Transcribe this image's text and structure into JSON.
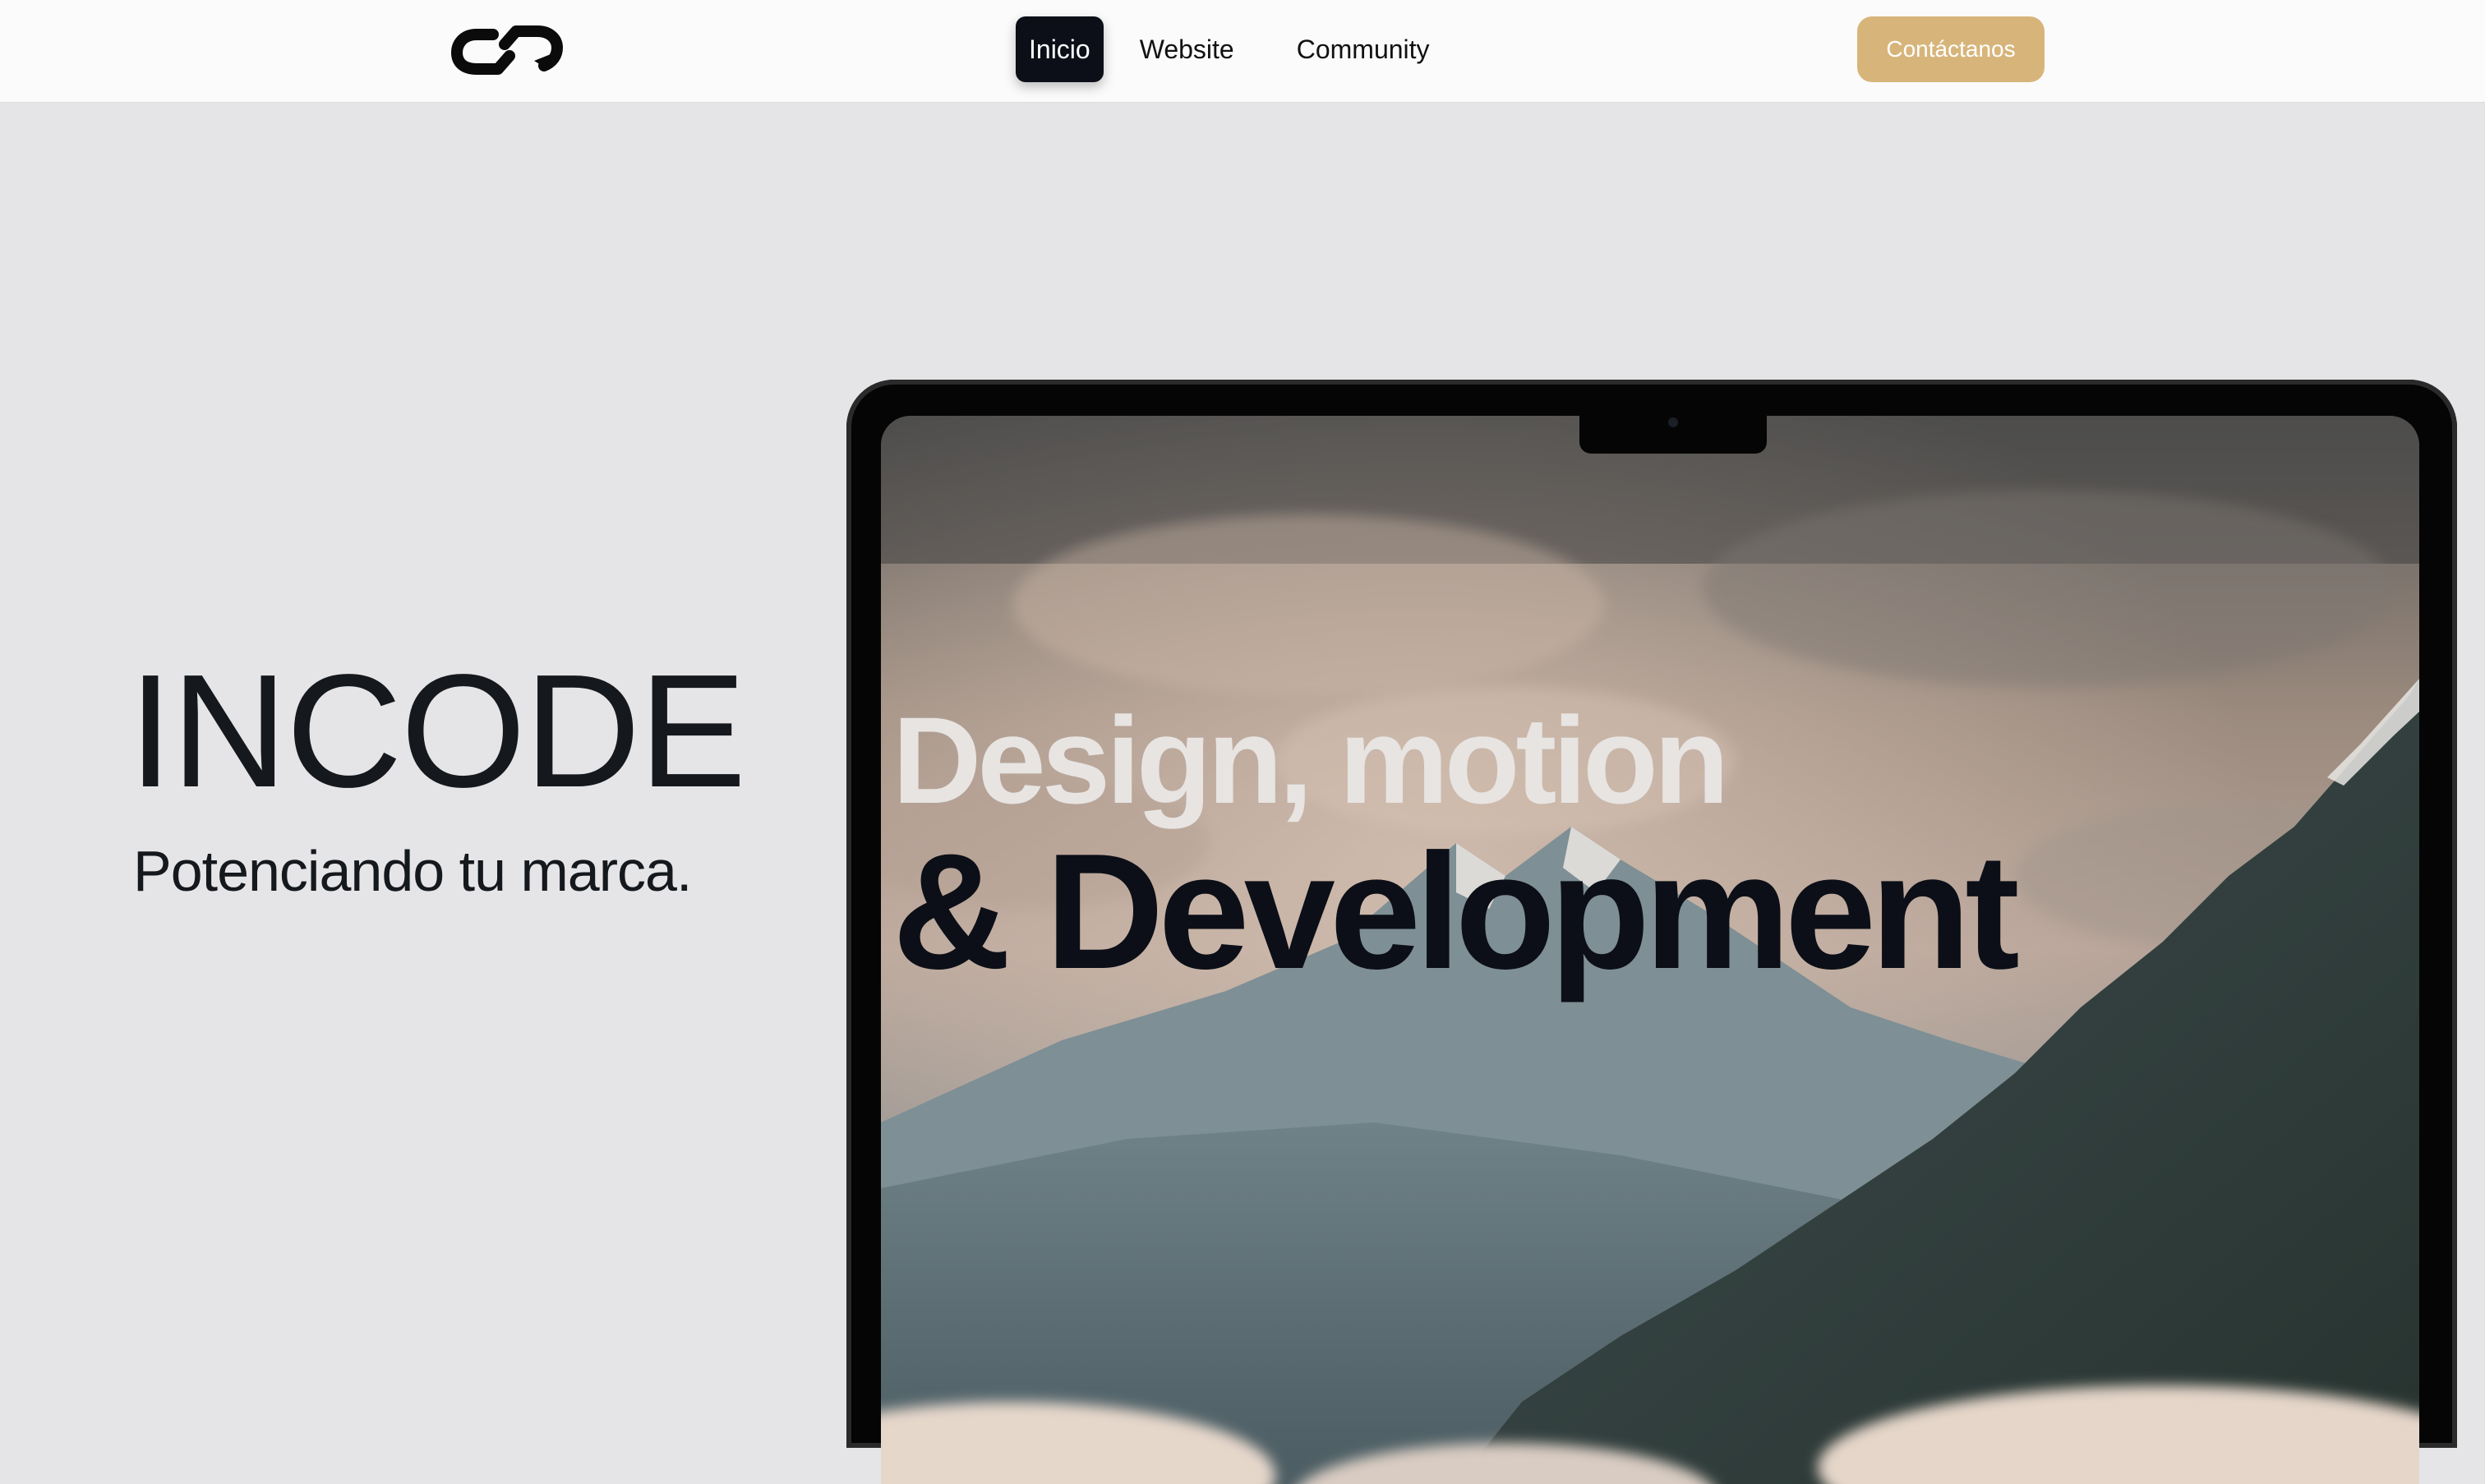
{
  "nav": {
    "logo_icon": "incode-logo-icon",
    "links": [
      "Inicio",
      "Website",
      "Community"
    ],
    "active_index": 0,
    "cta_label": "Contáctanos"
  },
  "hero": {
    "title": "INCODE",
    "subtitle": "Potenciando tu marca."
  },
  "screen": {
    "headline_line1": "Design, motion",
    "headline_line2": "& Development"
  },
  "colors": {
    "page_background": "#e5e5e7",
    "navbar_background": "#fbfbfb",
    "active_tab": "#0c0f17",
    "cta_button": "#d7b57a",
    "text_dark": "#15181c"
  }
}
